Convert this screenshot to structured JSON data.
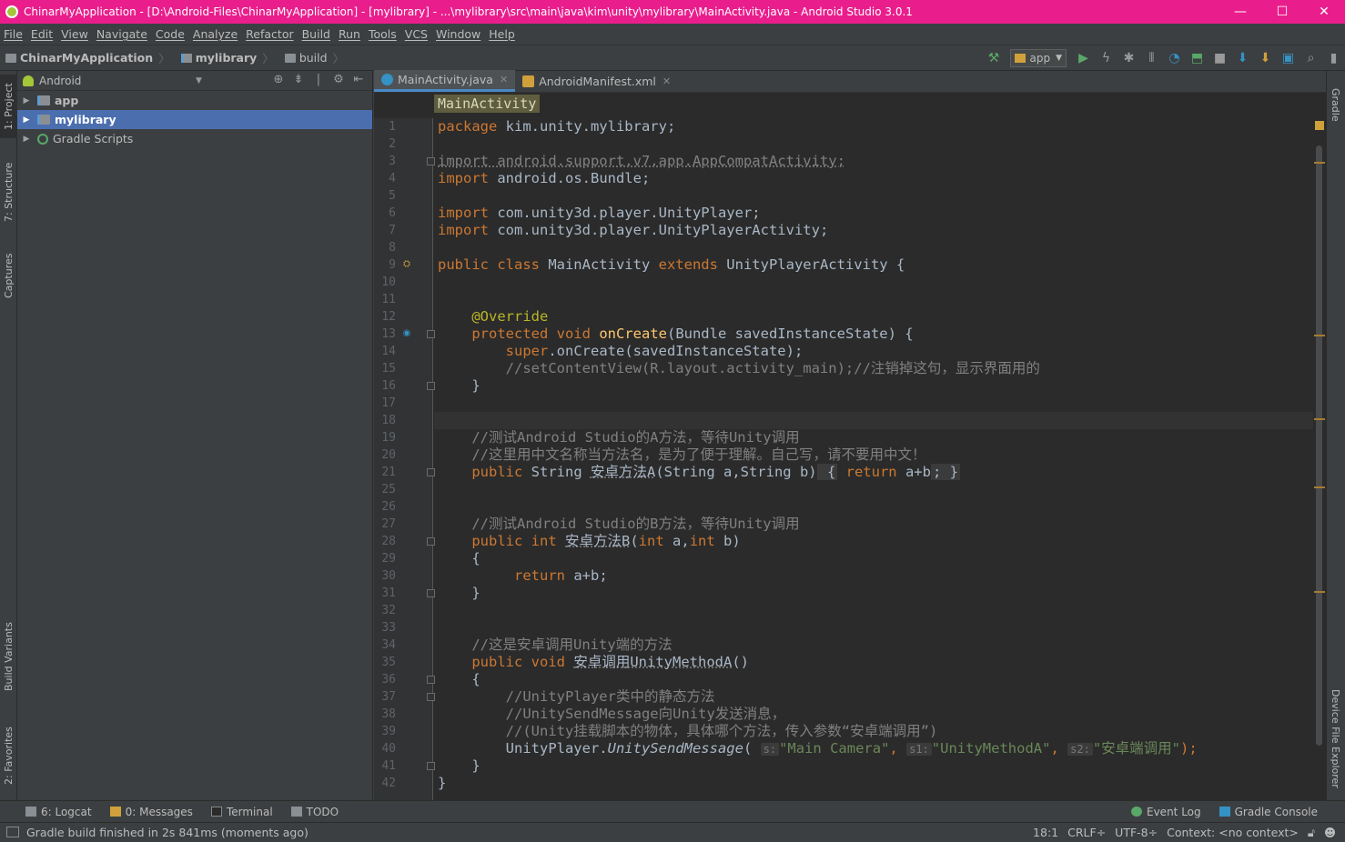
{
  "window": {
    "title": "ChinarMyApplication - [D:\\Android-Files\\ChinarMyApplication] - [mylibrary] - ...\\mylibrary\\src\\main\\java\\kim\\unity\\mylibrary\\MainActivity.java - Android Studio 3.0.1",
    "minimize": "—",
    "maximize": "☐",
    "close": "✕"
  },
  "menu": [
    "File",
    "Edit",
    "View",
    "Navigate",
    "Code",
    "Analyze",
    "Refactor",
    "Build",
    "Run",
    "Tools",
    "VCS",
    "Window",
    "Help"
  ],
  "nav": {
    "project": "ChinarMyApplication",
    "module": "mylibrary",
    "folder": "build",
    "run_config": "app"
  },
  "left_tabs": {
    "project": "1: Project",
    "structure": "7: Structure",
    "captures": "Captures",
    "build_variants": "Build Variants",
    "favorites": "2: Favorites"
  },
  "right_tabs": {
    "gradle": "Gradle",
    "device_file_explorer": "Device File Explorer"
  },
  "project_panel": {
    "view": "Android",
    "items": [
      {
        "label": "app"
      },
      {
        "label": "mylibrary"
      },
      {
        "label": "Gradle Scripts"
      }
    ]
  },
  "editor": {
    "tabs": [
      {
        "label": "MainActivity.java"
      },
      {
        "label": "AndroidManifest.xml"
      }
    ],
    "breadcrumb": "MainActivity",
    "line_numbers": [
      "1",
      "2",
      "3",
      "4",
      "5",
      "6",
      "7",
      "8",
      "9",
      "10",
      "11",
      "12",
      "13",
      "14",
      "15",
      "16",
      "17",
      "18",
      "19",
      "20",
      "21",
      "25",
      "26",
      "27",
      "28",
      "29",
      "30",
      "31",
      "32",
      "33",
      "34",
      "35",
      "36",
      "37",
      "38",
      "39",
      "40",
      "41",
      "42"
    ],
    "code": {
      "l1_kw": "package",
      "l1_rest": " kim.unity.mylibrary;",
      "l3": "import android.support.v7.app.AppCompatActivity;",
      "l4_kw": "import",
      "l4_rest": " android.os.Bundle;",
      "l6_kw": "import",
      "l6_rest": " com.unity3d.player.UnityPlayer;",
      "l7_kw": "import",
      "l7_rest": " com.unity3d.player.UnityPlayerActivity;",
      "l9_kw1": "public class",
      "l9_name": " MainActivity ",
      "l9_kw2": "extends",
      "l9_rest": " UnityPlayerActivity {",
      "l12": "@Override",
      "l13_kw": "protected void",
      "l13_fn": "onCreate",
      "l13_rest": "(Bundle savedInstanceState) {",
      "l14_kw": "super",
      "l14_rest": ".onCreate(savedInstanceState);",
      "l15": "//setContentView(R.layout.activity_main);//注销掉这句，显示界面用的",
      "l16": "}",
      "l19": "//测试Android Studio的A方法，等待Unity调用",
      "l20": "//这里用中文名称当方法名，是为了便于理解。自己写，请不要用中文！",
      "l21_kw": "public",
      "l21_a": " String ",
      "l21_fn": "安卓方法A",
      "l21_b": "(String a,String b)",
      "l21_open": " {",
      "l21_kw2": " return",
      "l21_c": " a+b",
      "l21_close": "; }",
      "l27": "//测试Android Studio的B方法，等待Unity调用",
      "l28_kw": "public int",
      "l28_fn": "安卓方法B",
      "l28_a": "(",
      "l28_kw2": "int",
      "l28_b": " a,",
      "l28_kw3": "int",
      "l28_c": " b)",
      "l29": "{",
      "l30_kw": "return",
      "l30_rest": " a+b;",
      "l31": "}",
      "l34": "//这是安卓调用Unity端的方法",
      "l35_kw": "public void",
      "l35_fn": "安卓调用UnityMethodA",
      "l35_rest": "()",
      "l36": "{",
      "l37": "//UnityPlayer类中的静态方法",
      "l38": "//UnitySendMessage向Unity发送消息，",
      "l39": "//(Unity挂载脚本的物体，具体哪个方法，传入参数“安卓端调用”)",
      "l40_a": "UnityPlayer.",
      "l40_fn": "UnitySendMessage",
      "l40_b": "(",
      "l40_h1": "s:",
      "l40_s1": "\"Main Camera\"",
      "l40_c1": ",",
      "l40_h2": "s1:",
      "l40_s2": "\"UnityMethodA\"",
      "l40_c2": ",",
      "l40_h3": "s2:",
      "l40_s3": "\"安卓端调用\"",
      "l40_end": ");",
      "l41": "}",
      "l42": "}"
    }
  },
  "tool_windows": {
    "logcat": "6: Logcat",
    "messages": "0: Messages",
    "terminal": "Terminal",
    "todo": "TODO",
    "event_log": "Event Log",
    "gradle_console": "Gradle Console"
  },
  "status": {
    "message": "Gradle build finished in 2s 841ms (moments ago)",
    "position": "18:1",
    "line_sep": "CRLF÷",
    "encoding": "UTF-8÷",
    "context": "Context: <no context>"
  }
}
